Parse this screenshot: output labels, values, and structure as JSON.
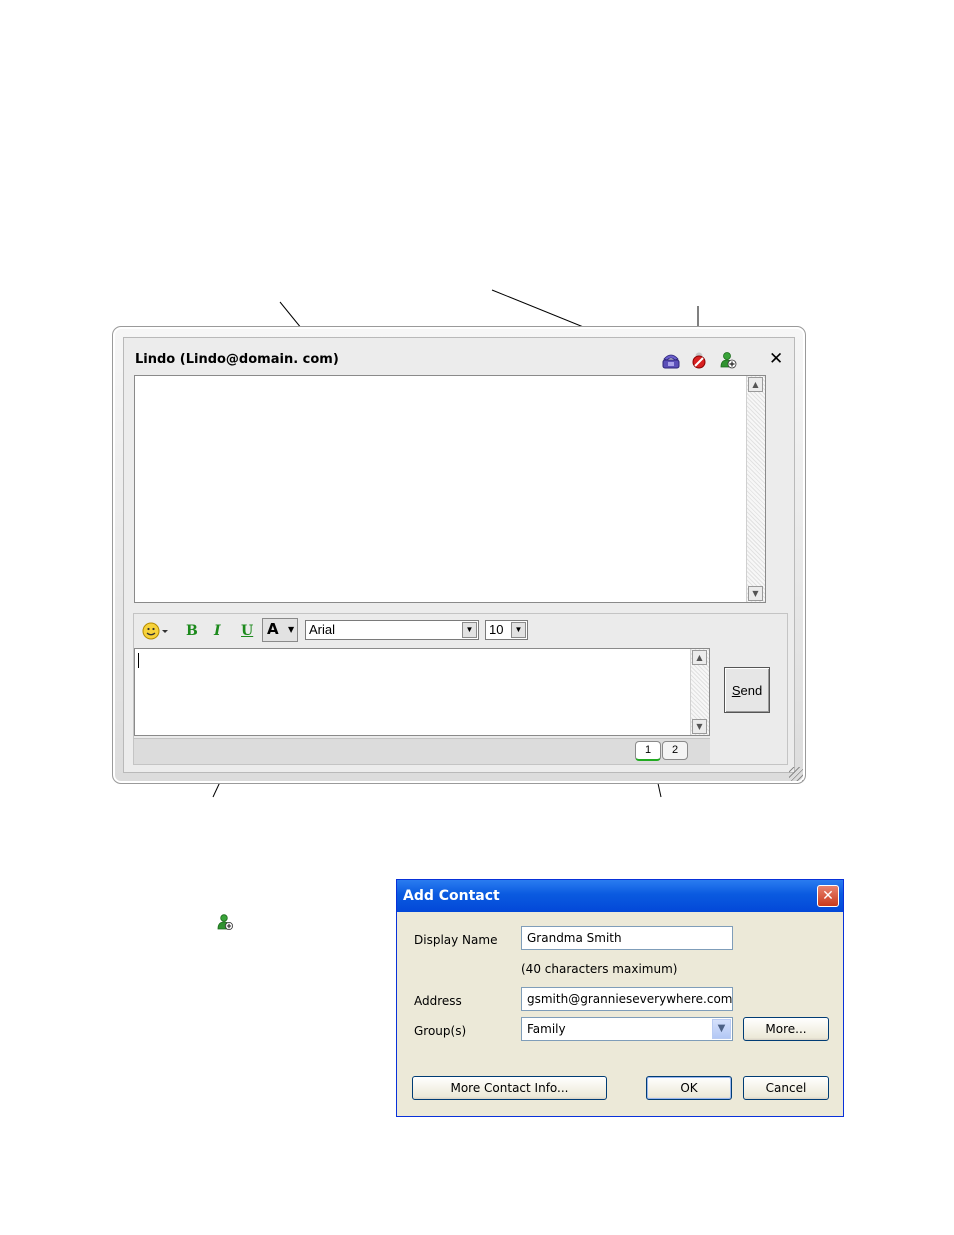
{
  "chat_window": {
    "title": "Lindo (Lindo@domain. com)",
    "icons": [
      "phone-icon",
      "block-contact-icon",
      "add-contact-icon",
      "close-icon"
    ],
    "close_glyph": "✕",
    "toolbar": {
      "emoticon_icon": "smiley-icon",
      "bold_label": "B",
      "italic_label": "I",
      "underline_label": "U",
      "color_label": "A",
      "font_value": "Arial",
      "size_value": "10"
    },
    "send_label_first": "S",
    "send_label_rest": "end",
    "tabs": [
      "1",
      "2"
    ],
    "active_tab": 0
  },
  "add_contact_dialog": {
    "title": "Add Contact",
    "close_glyph": "✕",
    "display_name_label": "Display Name",
    "display_name_value": "Grandma Smith",
    "max_chars_note": "(40 characters maximum)",
    "address_label": "Address",
    "address_value": "gsmith@grannieseverywhere.com",
    "groups_label": "Group(s)",
    "groups_value": "Family",
    "more_button": "More...",
    "more_contact_info_button": "More Contact Info...",
    "ok_button": "OK",
    "cancel_button": "Cancel"
  },
  "colors": {
    "xp_title_blue": "#0a5ae0",
    "format_green": "#1c8a1c",
    "active_tab_green": "#22aa22",
    "close_red": "#c9391c"
  }
}
